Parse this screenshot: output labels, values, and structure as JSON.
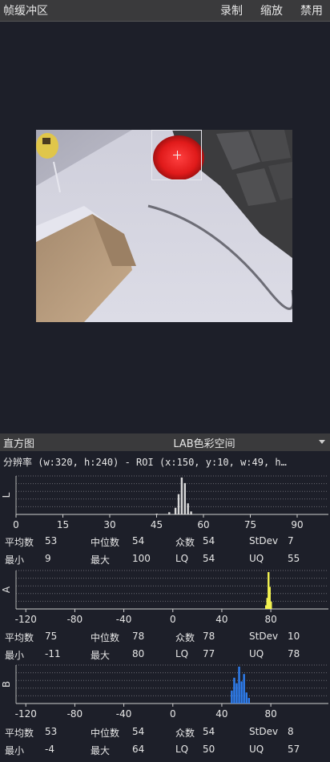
{
  "window": {
    "title": "帧缓冲区"
  },
  "menu": {
    "record": "录制",
    "zoom": "缩放",
    "disable": "禁用"
  },
  "histogram": {
    "header_label": "直方图",
    "colorspace": "LAB色彩空间",
    "resolution_text": "分辨率 (w:320, h:240) - ROI (x:150, y:10, w:49, h…"
  },
  "channels": [
    {
      "axis_label": "L",
      "color": "#d9d9d9",
      "ticks": [
        "0",
        "15",
        "30",
        "45",
        "60",
        "75",
        "90"
      ],
      "tick_values": [
        0,
        15,
        30,
        45,
        60,
        75,
        90
      ],
      "xrange": [
        0,
        100
      ],
      "peaks": [
        [
          45,
          0.02
        ],
        [
          49,
          0.06
        ],
        [
          51,
          0.18
        ],
        [
          52,
          0.55
        ],
        [
          53,
          1.0
        ],
        [
          54,
          0.85
        ],
        [
          55,
          0.3
        ],
        [
          56,
          0.08
        ]
      ],
      "stats": {
        "mean_label": "平均数",
        "mean": "53",
        "median_label": "中位数",
        "median": "54",
        "mode_label": "众数",
        "mode": "54",
        "stdev_label": "StDev",
        "stdev": "7",
        "min_label": "最小",
        "min": "9",
        "max_label": "最大",
        "max": "100",
        "lq_label": "LQ",
        "lq": "54",
        "uq_label": "UQ",
        "uq": "55"
      }
    },
    {
      "axis_label": "A",
      "color": "#f2f251",
      "ticks": [
        "-120",
        "-80",
        "-40",
        "0",
        "40",
        "80"
      ],
      "tick_values": [
        -120,
        -80,
        -40,
        0,
        40,
        80
      ],
      "xrange": [
        -128,
        127
      ],
      "peaks": [
        [
          76,
          0.1
        ],
        [
          77,
          0.3
        ],
        [
          78,
          1.0
        ],
        [
          79,
          0.6
        ],
        [
          80,
          0.2
        ]
      ],
      "stats": {
        "mean_label": "平均数",
        "mean": "75",
        "median_label": "中位数",
        "median": "78",
        "mode_label": "众数",
        "mode": "78",
        "stdev_label": "StDev",
        "stdev": "10",
        "min_label": "最小",
        "min": "-11",
        "max_label": "最大",
        "max": "80",
        "lq_label": "LQ",
        "lq": "77",
        "uq_label": "UQ",
        "uq": "78"
      }
    },
    {
      "axis_label": "B",
      "color": "#2e7ef0",
      "ticks": [
        "-120",
        "-80",
        "-40",
        "0",
        "40",
        "80"
      ],
      "tick_values": [
        -120,
        -80,
        -40,
        0,
        40,
        80
      ],
      "xrange": [
        -128,
        127
      ],
      "peaks": [
        [
          48,
          0.35
        ],
        [
          50,
          0.7
        ],
        [
          52,
          0.55
        ],
        [
          54,
          1.0
        ],
        [
          56,
          0.6
        ],
        [
          58,
          0.8
        ],
        [
          60,
          0.3
        ],
        [
          62,
          0.15
        ]
      ],
      "stats": {
        "mean_label": "平均数",
        "mean": "53",
        "median_label": "中位数",
        "median": "54",
        "mode_label": "众数",
        "mode": "54",
        "stdev_label": "StDev",
        "stdev": "8",
        "min_label": "最小",
        "min": "-4",
        "max_label": "最大",
        "max": "64",
        "lq_label": "LQ",
        "lq": "50",
        "uq_label": "UQ",
        "uq": "57"
      }
    }
  ]
}
